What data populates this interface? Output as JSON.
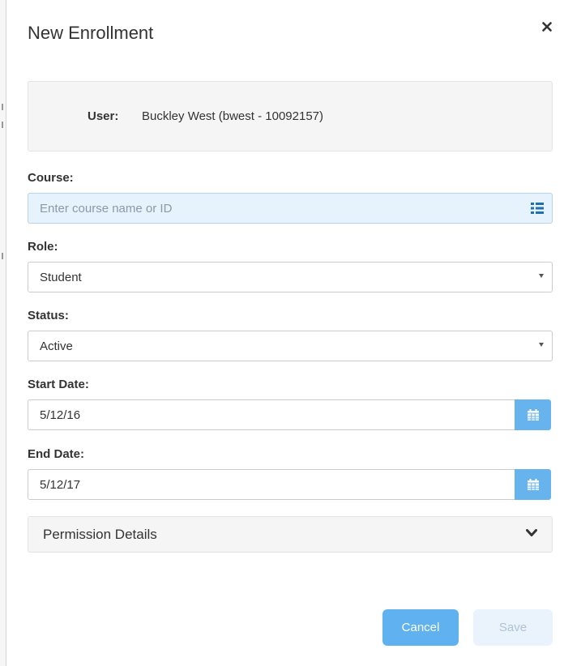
{
  "modal": {
    "title": "New Enrollment"
  },
  "user": {
    "label": "User:",
    "value": "Buckley West (bwest - 10092157)"
  },
  "course": {
    "label": "Course:",
    "placeholder": "Enter course name or ID",
    "icon": "list-icon"
  },
  "role": {
    "label": "Role:",
    "selected": "Student"
  },
  "status": {
    "label": "Status:",
    "selected": "Active"
  },
  "start_date": {
    "label": "Start Date:",
    "value": "5/12/16",
    "icon": "calendar-icon"
  },
  "end_date": {
    "label": "End Date:",
    "value": "5/12/17",
    "icon": "calendar-icon"
  },
  "permissions": {
    "label": "Permission Details",
    "icon": "chevron-down-icon"
  },
  "actions": {
    "cancel_label": "Cancel",
    "save_label": "Save"
  },
  "colors": {
    "accent": "#66b3ee",
    "course_input_bg": "#e6f2fc",
    "panel_bg": "#f5f5f5",
    "save_disabled_bg": "#eaf3fc"
  }
}
